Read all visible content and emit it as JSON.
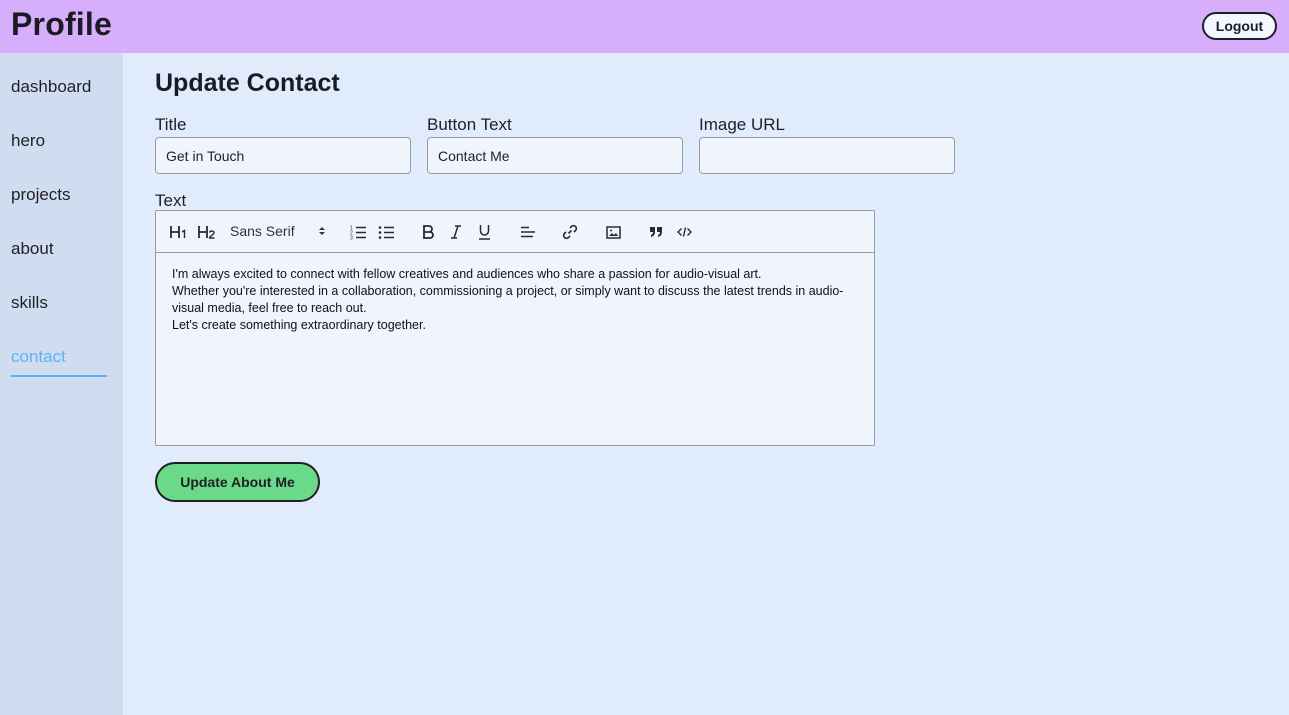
{
  "header": {
    "title": "Profile",
    "logout_label": "Logout"
  },
  "sidebar": {
    "items": [
      {
        "label": "dashboard"
      },
      {
        "label": "hero"
      },
      {
        "label": "projects"
      },
      {
        "label": "about"
      },
      {
        "label": "skills"
      },
      {
        "label": "contact",
        "active": true
      }
    ],
    "active_color": "#5cb3f2"
  },
  "form": {
    "heading": "Update Contact",
    "title_label": "Title",
    "title_value": "Get in Touch",
    "button_text_label": "Button Text",
    "button_text_value": "Contact Me",
    "image_url_label": "Image URL",
    "image_url_value": "",
    "text_label": "Text",
    "submit_label": "Update About Me"
  },
  "editor": {
    "font_select": "Sans Serif",
    "toolbar_icons": [
      "h1-icon",
      "h2-icon",
      "ordered-list-icon",
      "bullet-list-icon",
      "bold-icon",
      "italic-icon",
      "underline-icon",
      "align-left-icon",
      "link-icon",
      "image-icon",
      "blockquote-icon",
      "code-icon"
    ],
    "lines": [
      "I'm always excited to connect with fellow creatives and audiences who share a passion for audio-visual art.",
      "Whether you're interested in a collaboration, commissioning a project, or simply want to discuss the latest trends in audio-visual media, feel free to reach out.",
      "Let's create something extraordinary together."
    ]
  },
  "colors": {
    "header_bg": "#d6aefb",
    "sidebar_bg": "#d0ddf1",
    "main_bg": "#e0ebfc",
    "submit_bg": "#6ad98a"
  }
}
